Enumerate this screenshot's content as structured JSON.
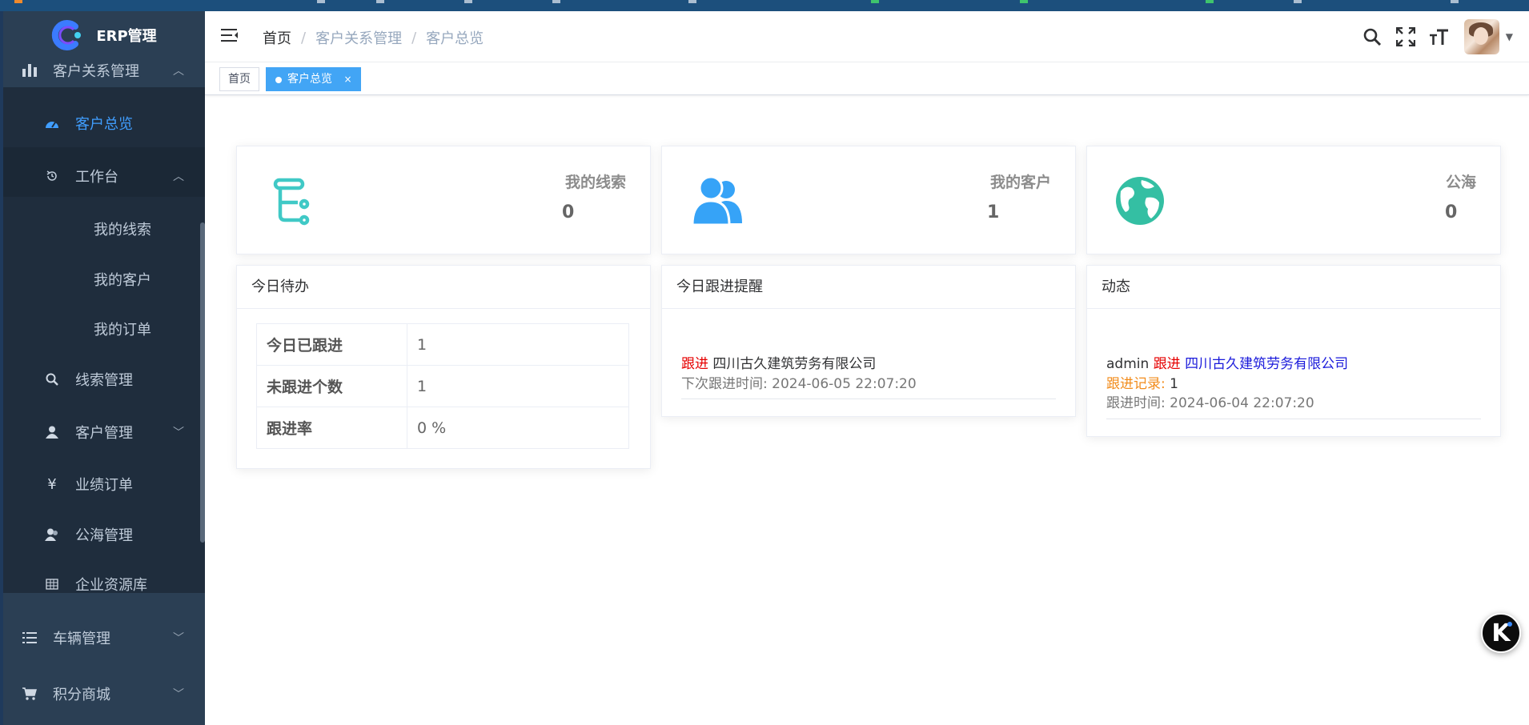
{
  "app": {
    "logo_text": "ERP管理"
  },
  "sidebar": {
    "items": [
      {
        "label": "客户关系管理",
        "icon": "bar-chart-icon",
        "chev": "^"
      },
      {
        "label": "客户总览",
        "icon": "dashboard-icon",
        "active": true
      },
      {
        "label": "工作台",
        "icon": "history-icon",
        "chev": "^"
      },
      {
        "label": "我的线索"
      },
      {
        "label": "我的客户"
      },
      {
        "label": "我的订单"
      },
      {
        "label": "线索管理",
        "icon": "search-icon"
      },
      {
        "label": "客户管理",
        "icon": "user-icon",
        "chev": "v"
      },
      {
        "label": "业绩订单",
        "icon": "yen-icon"
      },
      {
        "label": "公海管理",
        "icon": "users-icon"
      },
      {
        "label": "企业资源库",
        "icon": "table-icon"
      },
      {
        "label": "车辆管理",
        "icon": "list-icon",
        "chev": "v"
      },
      {
        "label": "积分商城",
        "icon": "cart-icon",
        "chev": "v"
      }
    ]
  },
  "breadcrumb": {
    "items": [
      "首页",
      "客户关系管理",
      "客户总览"
    ],
    "separator": "/"
  },
  "tags": {
    "home": "首页",
    "active": "客户总览",
    "close": "×"
  },
  "stats": [
    {
      "label": "我的线索",
      "value": "0",
      "color": "#40c9c6"
    },
    {
      "label": "我的客户",
      "value": "1",
      "color": "#36a3f7"
    },
    {
      "label": "公海",
      "value": "0",
      "color": "#34bfa3"
    }
  ],
  "todo": {
    "title": "今日待办",
    "rows": [
      {
        "key": "今日已跟进",
        "value": "1"
      },
      {
        "key": "未跟进个数",
        "value": "1"
      },
      {
        "key": "跟进率",
        "value": "0 %"
      }
    ]
  },
  "reminder": {
    "title": "今日跟进提醒",
    "action": "跟进",
    "company": "四川古久建筑劳务有限公司",
    "next_label": "下次跟进时间:",
    "next_time": "2024-06-05 22:07:20"
  },
  "activity": {
    "title": "动态",
    "user": "admin",
    "action": "跟进",
    "company": "四川古久建筑劳务有限公司",
    "record_label": "跟进记录:",
    "record_value": "1",
    "time_label": "跟进时间:",
    "time_value": "2024-06-04 22:07:20"
  },
  "fab": {
    "letter": "K"
  }
}
